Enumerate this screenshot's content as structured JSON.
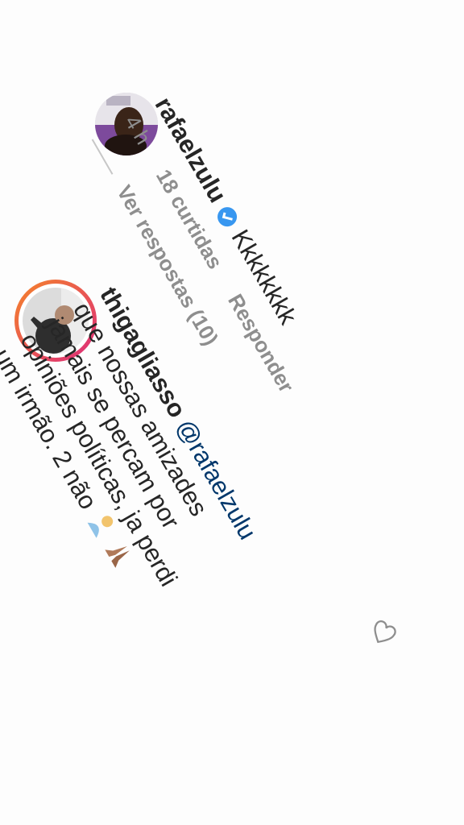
{
  "comment1": {
    "username": "rafaelzulu",
    "text": "Kkkkkkkk",
    "time": "4 h",
    "likes": "18 curtidas",
    "reply": "Responder",
    "view_replies": "Ver respostas (10)"
  },
  "comment2": {
    "username": "thigagliasso",
    "mention": "@rafaelzulu",
    "line1": "que nossas amizades",
    "line2": "jamais se percam por",
    "line3": "opiniões políticas, ja perdi",
    "line4": "um irmão. 2 não"
  },
  "colors": {
    "verified_blue": "#3897f0",
    "mention_blue": "#00376b",
    "meta_gray": "#8e8e8e",
    "story_ring_start": "#f58529",
    "story_ring_end": "#dd2a7b"
  },
  "icons": [
    "verified-badge-icon",
    "heart-icon",
    "prayer-hands-emoji",
    "praying-person-emoji"
  ]
}
